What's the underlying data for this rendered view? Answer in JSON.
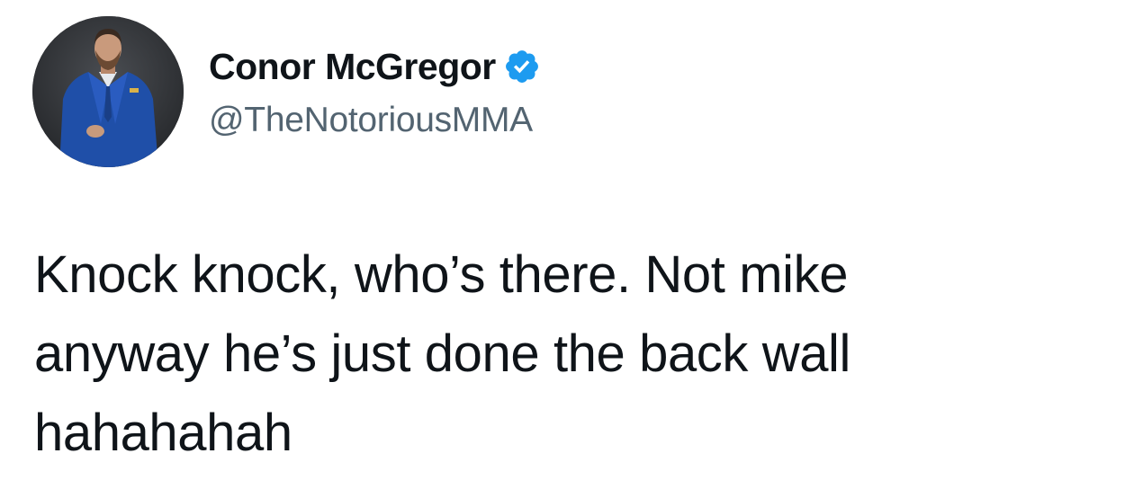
{
  "tweet": {
    "author": {
      "display_name": "Conor McGregor",
      "handle": "@TheNotoriousMMA",
      "verified": true,
      "avatar_icon": "profile-photo-man-in-blue-suit",
      "verified_icon": "verified-badge-icon"
    },
    "text_lines": [
      "Knock knock, who’s there. Not mike",
      "anyway he’s just done the back wall",
      "hahahahah"
    ]
  },
  "colors": {
    "text_primary": "#0f1419",
    "text_secondary": "#536471",
    "verified_blue": "#1d9bf0",
    "background": "#ffffff"
  }
}
